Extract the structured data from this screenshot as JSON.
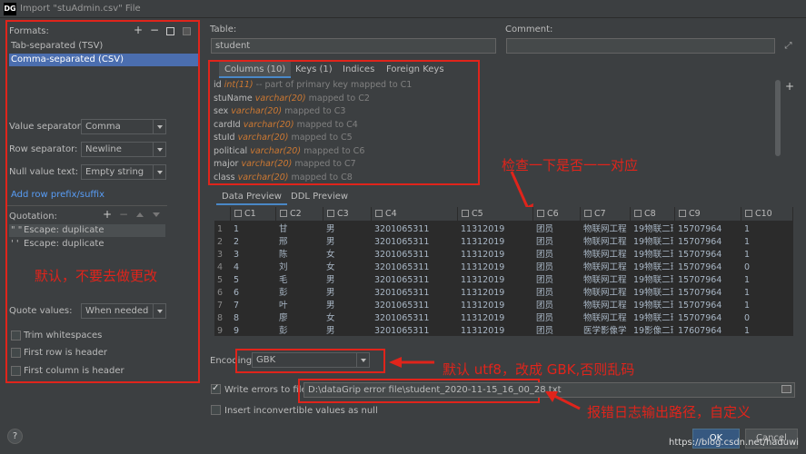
{
  "window": {
    "title": "Import \"stuAdmin.csv\" File",
    "app_icon": "DG"
  },
  "formats": {
    "label": "Formats:",
    "items": [
      "Tab-separated (TSV)",
      "Comma-separated (CSV)"
    ],
    "selected": 1
  },
  "value_separator": {
    "label": "Value separator:",
    "value": "Comma"
  },
  "row_separator": {
    "label": "Row separator:",
    "value": "Newline"
  },
  "null_value": {
    "label": "Null value text:",
    "value": "Empty string"
  },
  "add_prefix_link": "Add row prefix/suffix",
  "quotation": {
    "label": "Quotation:",
    "items": [
      {
        "quote": "\" \"",
        "desc": "Escape: duplicate"
      },
      {
        "quote": "' '",
        "desc": "Escape: duplicate"
      }
    ]
  },
  "left_annotation": "默认，不要去做更改",
  "quote_values": {
    "label": "Quote values:",
    "value": "When needed"
  },
  "options": [
    {
      "label": "Trim whitespaces",
      "checked": false
    },
    {
      "label": "First row is header",
      "checked": false
    },
    {
      "label": "First column is header",
      "checked": false
    }
  ],
  "table": {
    "label": "Table:",
    "value": "student"
  },
  "comment": {
    "label": "Comment:",
    "value": ""
  },
  "column_tabs": [
    "Columns (10)",
    "Keys (1)",
    "Indices",
    "Foreign Keys"
  ],
  "columns": [
    {
      "name": "id",
      "type": "int",
      "size": "11",
      "note": "-- part of primary key mapped to C1"
    },
    {
      "name": "stuName",
      "type": "varchar",
      "size": "20",
      "note": "mapped to C2"
    },
    {
      "name": "sex",
      "type": "varchar",
      "size": "20",
      "note": "mapped to C3"
    },
    {
      "name": "cardId",
      "type": "varchar",
      "size": "20",
      "note": "mapped to C4"
    },
    {
      "name": "stuId",
      "type": "varchar",
      "size": "20",
      "note": "mapped to C5"
    },
    {
      "name": "political",
      "type": "varchar",
      "size": "20",
      "note": "mapped to C6"
    },
    {
      "name": "major",
      "type": "varchar",
      "size": "20",
      "note": "mapped to C7"
    },
    {
      "name": "class",
      "type": "varchar",
      "size": "20",
      "note": "mapped to C8"
    }
  ],
  "mid_annotation": "检查一下是否一一对应",
  "preview_tabs": [
    "Data Preview",
    "DDL Preview"
  ],
  "grid": {
    "headers": [
      "C1",
      "C2",
      "C3",
      "C4",
      "C5",
      "C6",
      "C7",
      "C8",
      "C9",
      "C10"
    ],
    "rows": [
      [
        "1",
        "1",
        "甘",
        "男",
        "3201065311",
        "11312019",
        "团员",
        "物联网工程",
        "19物联二班",
        "15707964",
        "1"
      ],
      [
        "2",
        "2",
        "邢",
        "男",
        "3201065311",
        "11312019",
        "团员",
        "物联网工程",
        "19物联二班",
        "15707964",
        "1"
      ],
      [
        "3",
        "3",
        "陈",
        "女",
        "3201065311",
        "11312019",
        "团员",
        "物联网工程",
        "19物联二班",
        "15707964",
        "1"
      ],
      [
        "4",
        "4",
        "刘",
        "女",
        "3201065311",
        "11312019",
        "团员",
        "物联网工程",
        "19物联二班",
        "15707964",
        "0"
      ],
      [
        "5",
        "5",
        "毛",
        "男",
        "3201065311",
        "11312019",
        "团员",
        "物联网工程",
        "19物联二班",
        "15707964",
        "1"
      ],
      [
        "6",
        "6",
        "彭",
        "男",
        "3201065311",
        "11312019",
        "团员",
        "物联网工程",
        "19物联二班",
        "15707964",
        "1"
      ],
      [
        "7",
        "7",
        "叶",
        "男",
        "3201065311",
        "11312019",
        "团员",
        "物联网工程",
        "19物联二班",
        "15707964",
        "1"
      ],
      [
        "8",
        "8",
        "廖",
        "女",
        "3201065311",
        "11312019",
        "团员",
        "物联网工程",
        "19物联二班",
        "15707964",
        "0"
      ],
      [
        "9",
        "9",
        "彭",
        "男",
        "3201065311",
        "11312019",
        "团员",
        "医学影像学",
        "19影像二班",
        "17607964",
        "1"
      ]
    ]
  },
  "encoding": {
    "label": "Encoding:",
    "value": "GBK"
  },
  "encoding_annotation": "默认 utf8，改成 GBK,否则乱码",
  "write_errors": {
    "label": "Write errors to file:",
    "checked": true,
    "path": "D:\\dataGrip error file\\student_2020-11-15_16_00_28.txt"
  },
  "error_annotation": "报错日志输出路径，自定义",
  "insert_inconvertible": {
    "label": "Insert inconvertible values as null",
    "checked": false
  },
  "buttons": {
    "help": "?",
    "ok": "OK",
    "cancel": "Cancel"
  },
  "watermark": "https://blog.csdn.net/haduwi",
  "colors": {
    "annotation": "#e0241b",
    "selection": "#4b6eaf",
    "keyword": "#cc7832"
  }
}
